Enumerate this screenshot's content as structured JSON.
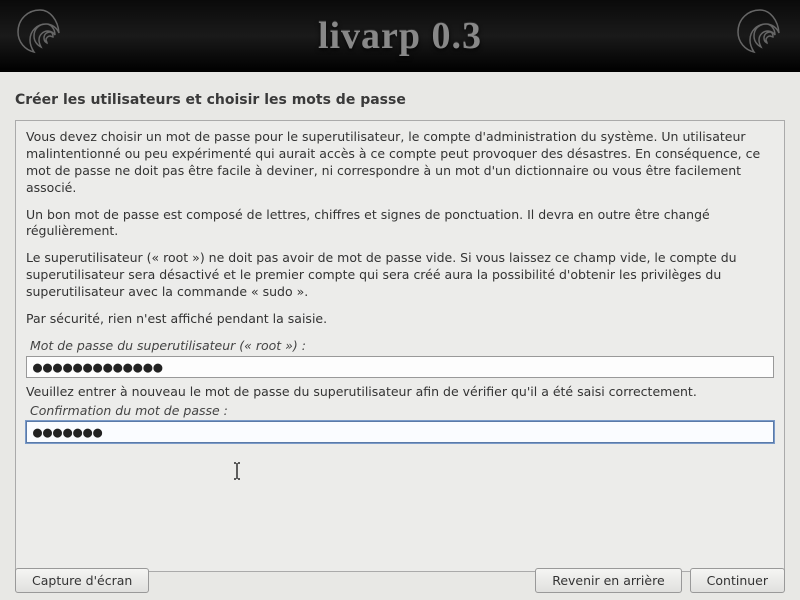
{
  "header": {
    "title": "livarp 0.3"
  },
  "page": {
    "title": "Créer les utilisateurs et choisir les mots de passe"
  },
  "body": {
    "para1": "Vous devez choisir un mot de passe pour le superutilisateur, le compte d'administration du système. Un utilisateur malintentionné ou peu expérimenté qui aurait accès à ce compte peut provoquer des désastres. En conséquence, ce mot de passe ne doit pas être facile à deviner, ni correspondre à un mot d'un dictionnaire ou vous être facilement associé.",
    "para2": "Un bon mot de passe est composé de lettres, chiffres et signes de ponctuation. Il devra en outre être changé régulièrement.",
    "para3": "Le superutilisateur (« root ») ne doit pas avoir de mot de passe vide. Si vous laissez ce champ vide, le compte du superutilisateur sera désactivé et le premier compte qui sera créé aura la possibilité d'obtenir les privilèges du superutilisateur avec la commande « sudo ».",
    "para4": "Par sécurité, rien n'est affiché pendant la saisie.",
    "label_password": "Mot de passe du superutilisateur (« root ») :",
    "password_value": "●●●●●●●●●●●●●",
    "instruction_confirm": "Veuillez entrer à nouveau le mot de passe du superutilisateur afin de vérifier qu'il a été saisi correctement.",
    "label_confirm": "Confirmation du mot de passe :",
    "confirm_value": "●●●●●●●"
  },
  "footer": {
    "screenshot": "Capture d'écran",
    "back": "Revenir en arrière",
    "continue": "Continuer"
  }
}
